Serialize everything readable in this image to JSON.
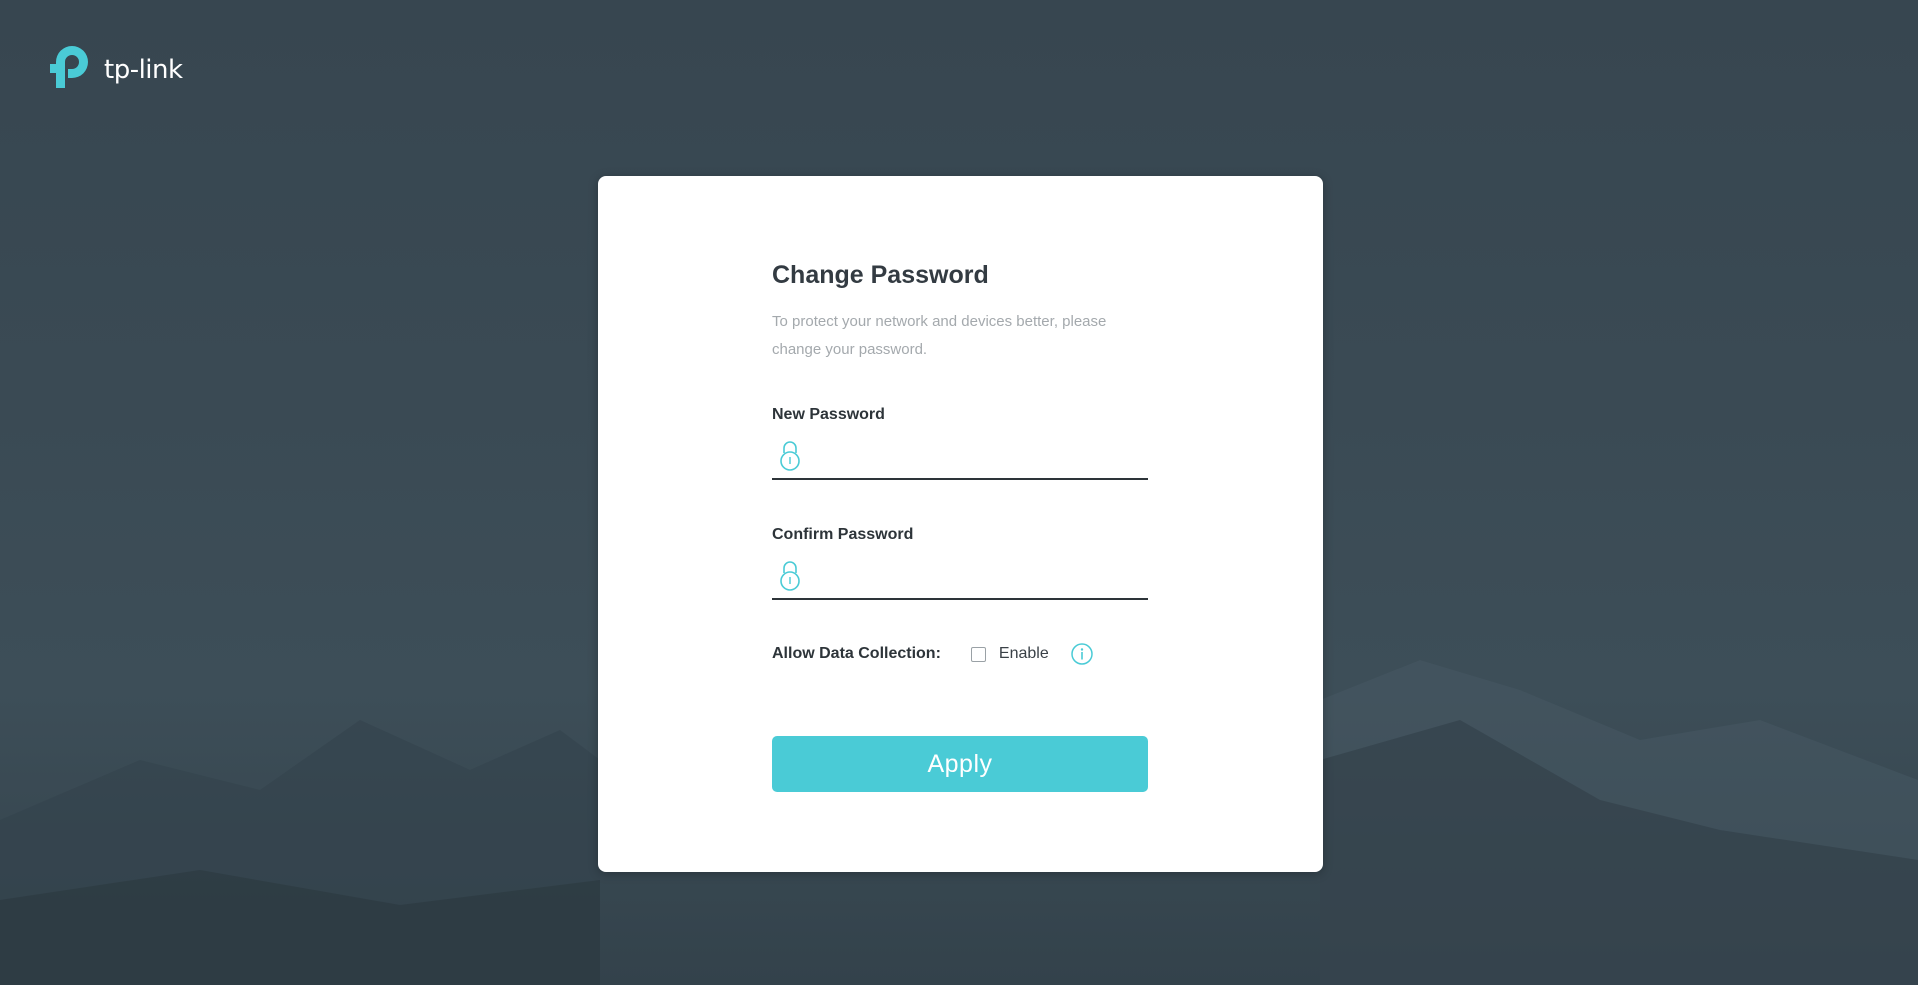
{
  "brand": {
    "name": "tp-link",
    "accent_color": "#4acbd6",
    "logo_icon": "tp-link-logo-icon"
  },
  "form": {
    "title": "Change Password",
    "description": "To protect your network and devices better, please change your password.",
    "new_password": {
      "label": "New Password",
      "value": "",
      "icon": "lock-icon"
    },
    "confirm_password": {
      "label": "Confirm Password",
      "value": "",
      "icon": "lock-icon"
    },
    "data_collection": {
      "label": "Allow Data Collection:",
      "checkbox_label": "Enable",
      "checked": false,
      "info_icon": "info-icon"
    },
    "apply_label": "Apply"
  }
}
